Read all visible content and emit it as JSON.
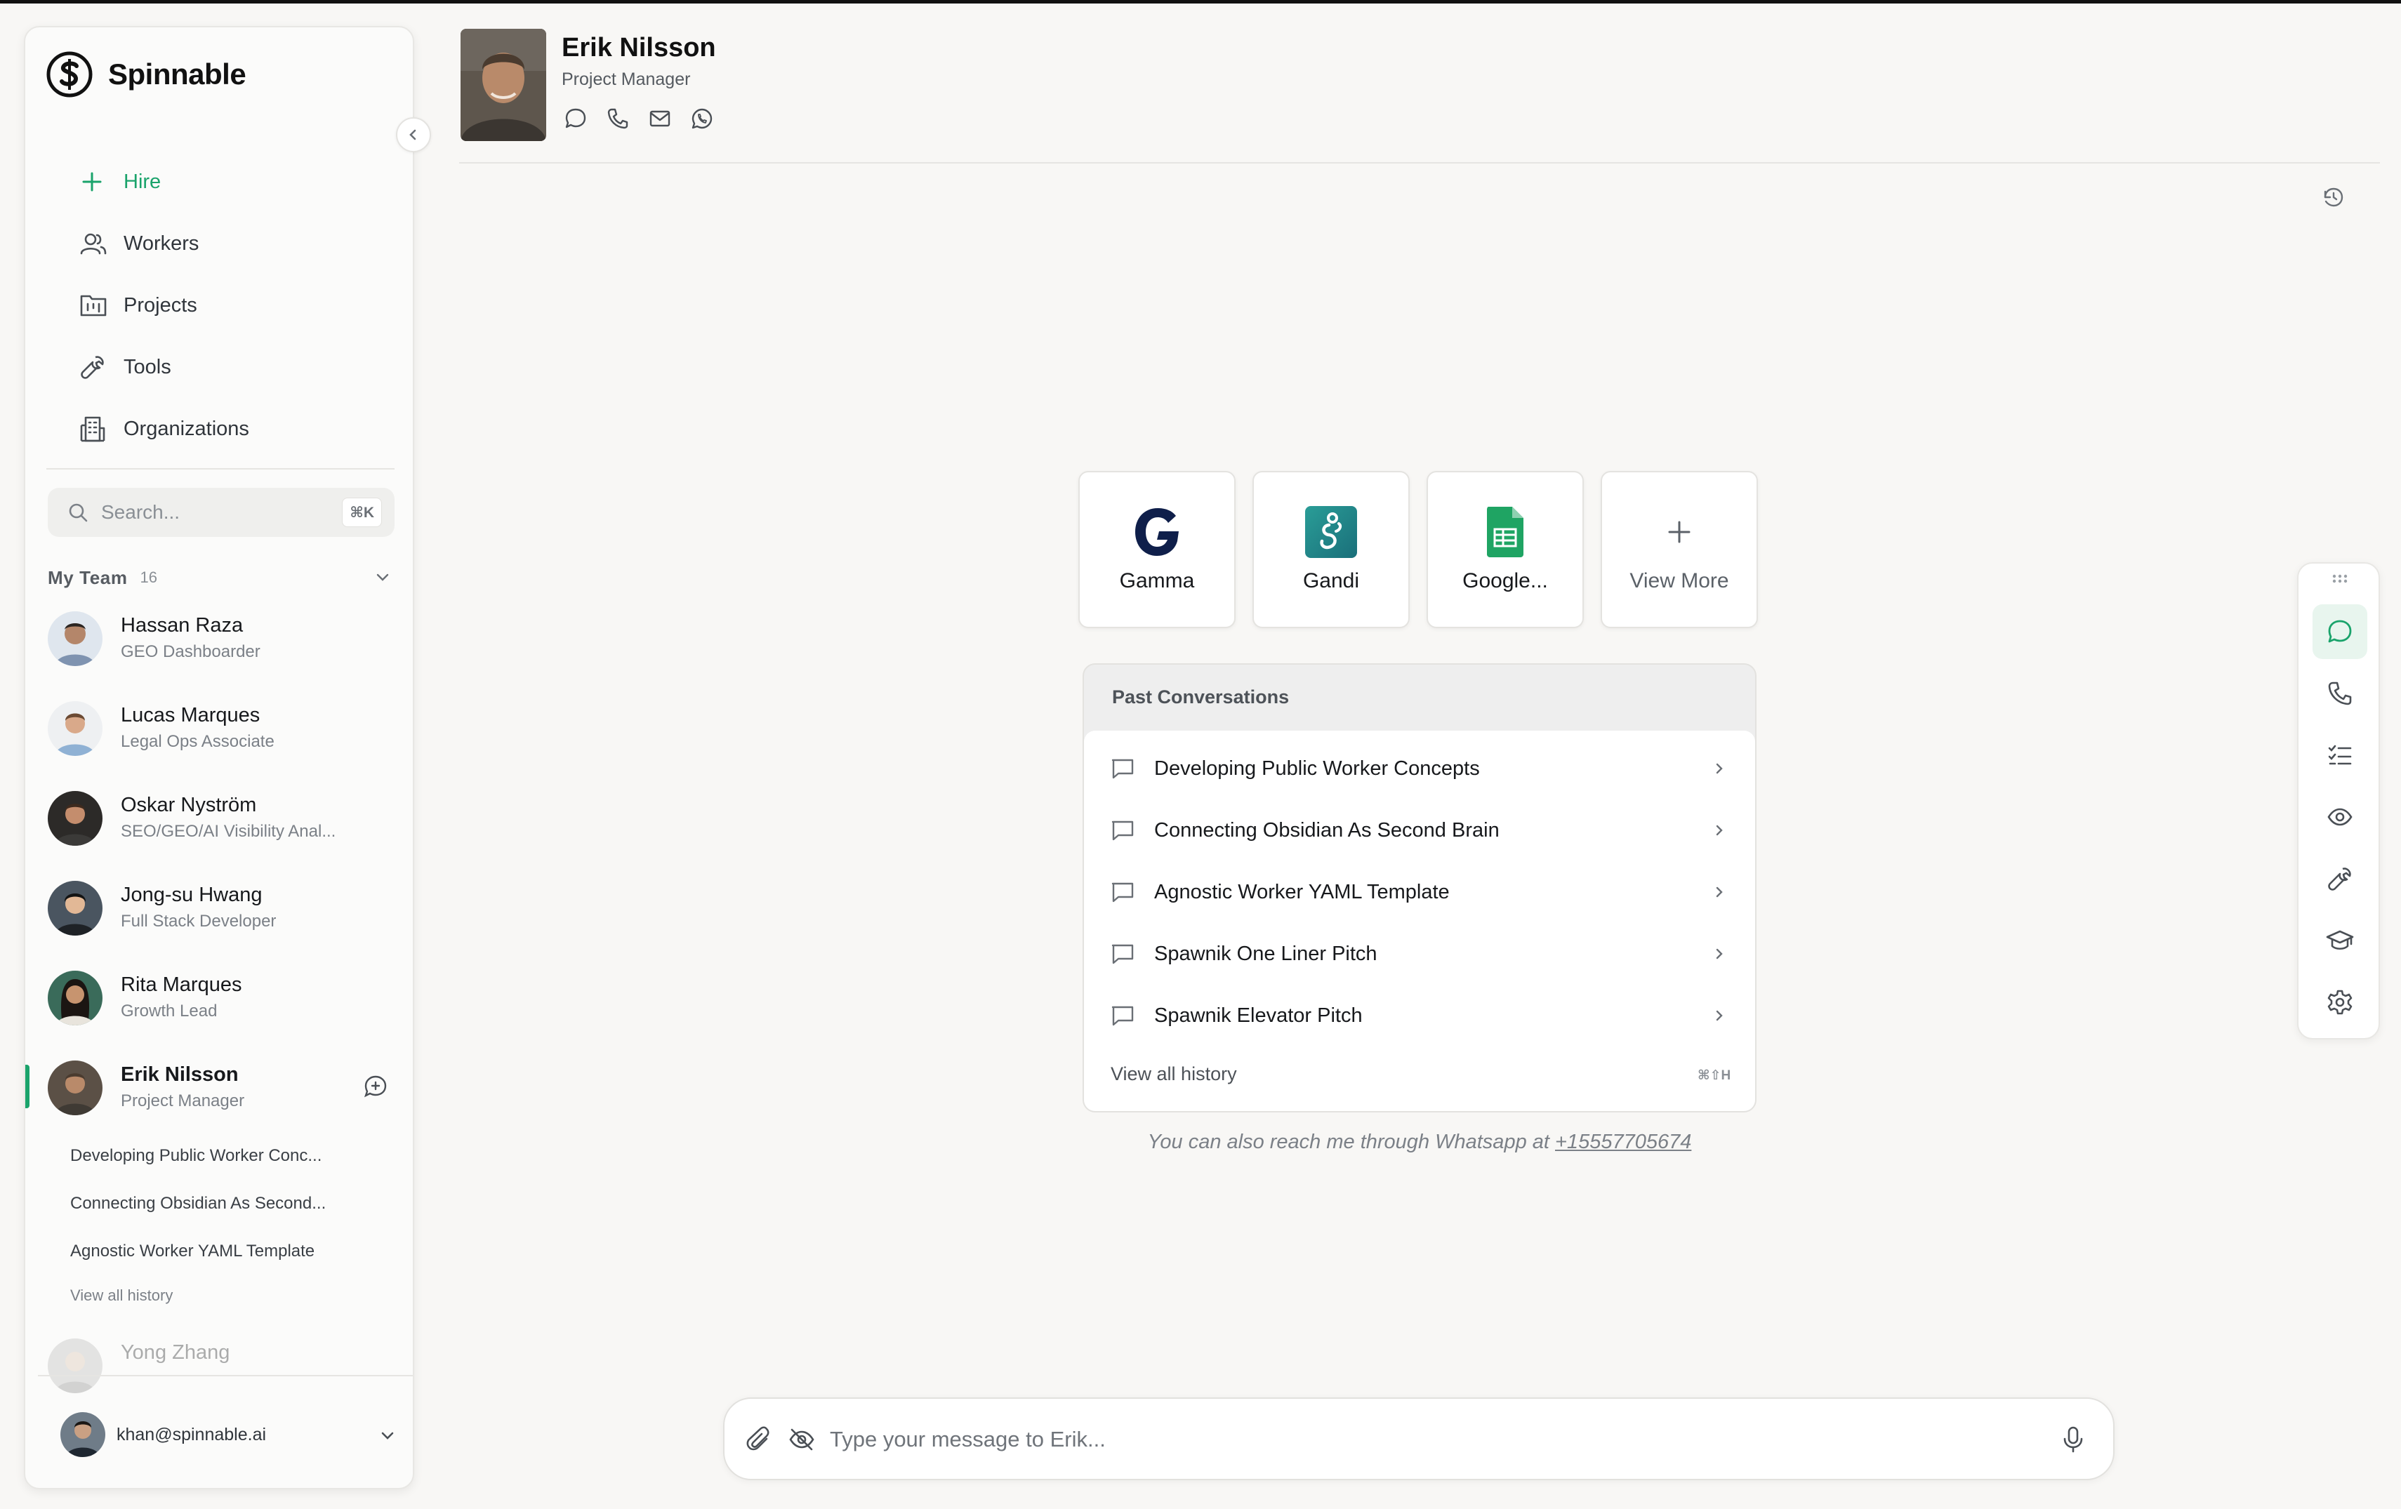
{
  "brand": {
    "name": "Spinnable"
  },
  "nav": {
    "hire": "Hire",
    "workers": "Workers",
    "projects": "Projects",
    "tools": "Tools",
    "organizations": "Organizations"
  },
  "search": {
    "placeholder": "Search...",
    "shortcut": "⌘K"
  },
  "team": {
    "title": "My Team",
    "count": "16",
    "members": [
      {
        "name": "Hassan Raza",
        "role": "GEO Dashboarder"
      },
      {
        "name": "Lucas Marques",
        "role": "Legal Ops Associate"
      },
      {
        "name": "Oskar Nyström",
        "role": "SEO/GEO/AI Visibility Anal..."
      },
      {
        "name": "Jong-su Hwang",
        "role": "Full Stack Developer"
      },
      {
        "name": "Rita Marques",
        "role": "Growth Lead"
      },
      {
        "name": "Erik Nilsson",
        "role": "Project Manager"
      },
      {
        "name": "Yong Zhang",
        "role": ""
      }
    ],
    "active_conversations": [
      "Developing Public Worker Conc...",
      "Connecting Obsidian As Second...",
      "Agnostic Worker YAML Template"
    ],
    "view_all_history": "View all history"
  },
  "account": {
    "email": "khan@spinnable.ai"
  },
  "header": {
    "name": "Erik Nilsson",
    "role": "Project Manager"
  },
  "tools": [
    {
      "label": "Gamma",
      "icon": "gamma-logo-icon"
    },
    {
      "label": "Gandi",
      "icon": "gandi-logo-icon"
    },
    {
      "label": "Google...",
      "icon": "google-sheets-icon"
    },
    {
      "label": "View More",
      "icon": "plus-icon"
    }
  ],
  "past_conversations": {
    "title": "Past Conversations",
    "items": [
      "Developing Public Worker Concepts",
      "Connecting Obsidian As Second Brain",
      "Agnostic Worker YAML Template",
      "Spawnik One Liner Pitch",
      "Spawnik Elevator Pitch"
    ],
    "view_all": "View all history",
    "view_all_shortcut": "⌘⇧H"
  },
  "whatsapp": {
    "text": "You can also reach me through Whatsapp at ",
    "number": "+15557705674"
  },
  "composer": {
    "placeholder": "Type your message to Erik..."
  },
  "colors": {
    "accent": "#1aa36b",
    "background": "#f8f7f5",
    "text": "#1f2328",
    "muted": "#7b8087"
  }
}
